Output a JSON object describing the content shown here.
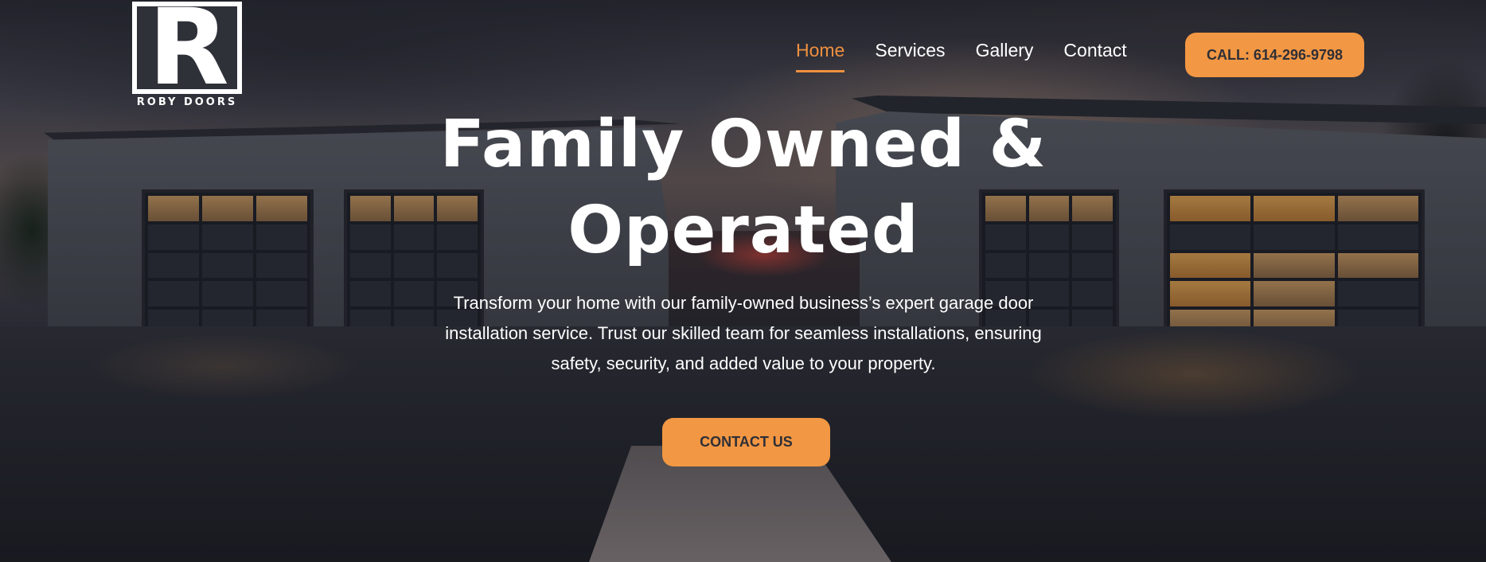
{
  "brand": {
    "logo_letter": "R",
    "logo_text": "ROBY DOORS"
  },
  "nav": {
    "items": [
      {
        "label": "Home",
        "active": true
      },
      {
        "label": "Services",
        "active": false
      },
      {
        "label": "Gallery",
        "active": false
      },
      {
        "label": "Contact",
        "active": false
      }
    ]
  },
  "call_button": {
    "label": "CALL: 614-296-9798"
  },
  "hero": {
    "headline": "Family Owned & Operated",
    "subtext": "Transform your home with our family-owned business’s expert garage door installation service. Trust our skilled team for seamless installations, ensuring safety, security, and added value to your property.",
    "cta_label": "CONTACT US"
  },
  "colors": {
    "accent": "#f29743",
    "nav_active": "#f0903f",
    "text": "#ffffff",
    "button_text": "#2f2f36"
  }
}
